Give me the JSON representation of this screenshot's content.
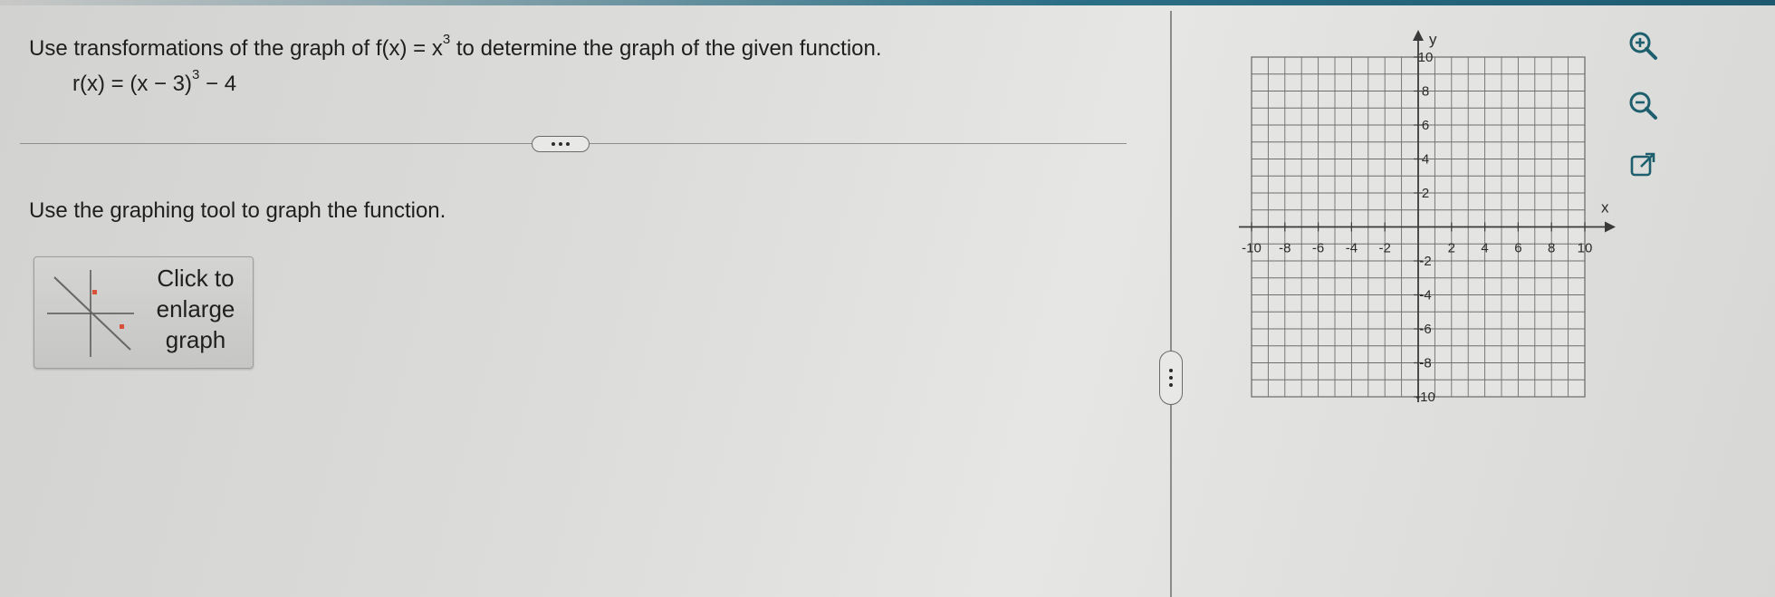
{
  "question": {
    "prefix": "Use transformations of the graph of f(x) = x",
    "exponent": "3",
    "suffix": " to determine the graph of the given function."
  },
  "equation": {
    "lhs": "r(x) = (x − 3)",
    "exponent": "3",
    "rhs": " − 4"
  },
  "instruction": "Use the graphing tool to graph the function.",
  "enlarge_button": {
    "lines": [
      "Click to",
      "enlarge",
      "graph"
    ]
  },
  "graph": {
    "x_axis_label": "x",
    "y_axis_label": "y",
    "x_range": [
      -10,
      10
    ],
    "y_range": [
      -10,
      10
    ],
    "x_tick_labels": [
      "-10",
      "-8",
      "-6",
      "-4",
      "-2",
      "2",
      "4",
      "6",
      "8",
      "10"
    ],
    "y_tick_labels": [
      "10",
      "8",
      "6",
      "4",
      "2",
      "-2",
      "-4",
      "-6",
      "-8",
      "-10"
    ]
  },
  "tools": [
    {
      "name": "zoom-in-icon"
    },
    {
      "name": "zoom-out-icon"
    },
    {
      "name": "popout-icon"
    }
  ],
  "colors": {
    "accent": "#1d5a70",
    "icon": "#1e5f6e",
    "enlarge_red": "#d9503a"
  }
}
